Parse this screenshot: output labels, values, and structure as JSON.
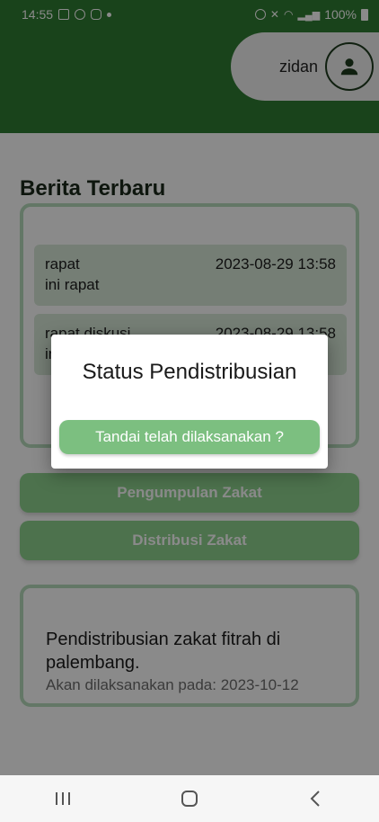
{
  "status_bar": {
    "time": "14:55",
    "battery": "100%"
  },
  "header": {
    "user_name": "zidan"
  },
  "news": {
    "title": "Berita Terbaru",
    "items": [
      {
        "title": "rapat",
        "body": "ini rapat",
        "date": "2023-08-29 13:58"
      },
      {
        "title": "rapat diskusi",
        "body": "ini",
        "date": "2023-08-29 13:58"
      }
    ]
  },
  "buttons": {
    "pengumpulan": "Pengumpulan Zakat",
    "distribusi": "Distribusi Zakat"
  },
  "distribution": {
    "title": "Pendistribusian zakat fitrah di palembang.",
    "date_text": "Akan dilaksanakan pada: 2023-10-12"
  },
  "dialog": {
    "title": "Status Pendistribusian",
    "button_label": "Tandai telah dilaksanakan ?"
  },
  "colors": {
    "primary": "#2f7d32",
    "button_green": "#8fd28f",
    "dialog_button": "#7cbf80",
    "card_border": "#b7dcbc"
  }
}
